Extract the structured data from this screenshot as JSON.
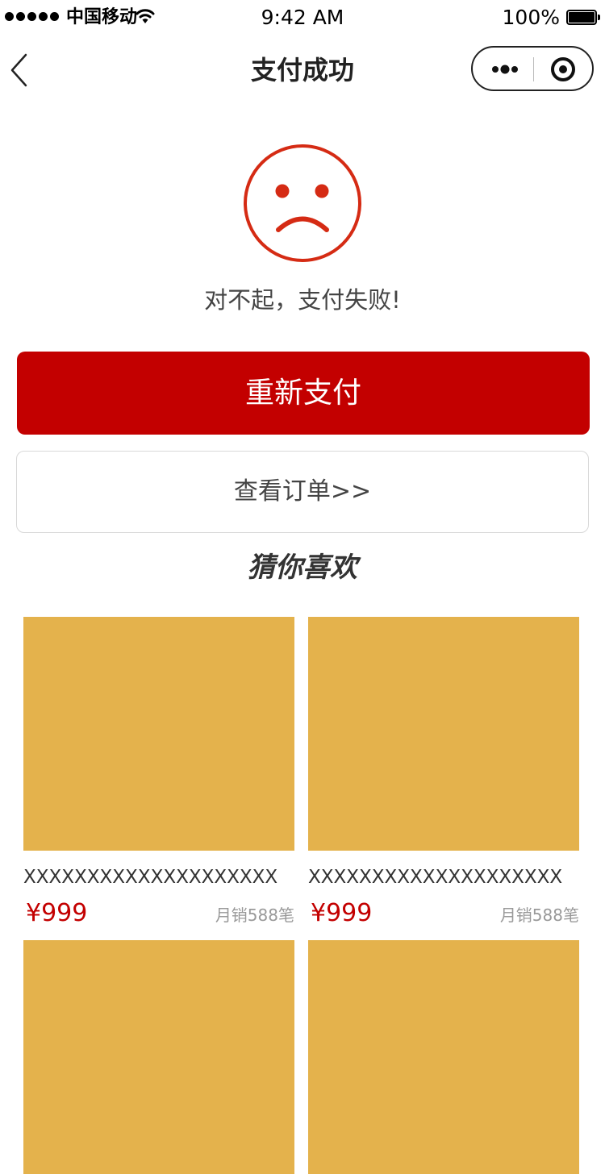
{
  "status_bar": {
    "carrier": "中国移动",
    "time": "9:42 AM",
    "battery": "100%",
    "signal_icon": "signal-dots-icon",
    "wifi_icon": "wifi-icon",
    "battery_icon": "battery-icon",
    "battery_level": 1.0
  },
  "nav": {
    "title": "支付成功",
    "back_icon": "chevron-left-icon",
    "more_icon": "more-dots-icon",
    "close_icon": "target-circle-icon"
  },
  "result": {
    "icon": "sad-face-icon",
    "message": "对不起，支付失败!",
    "icon_color": "#d52b14"
  },
  "actions": {
    "retry_label": "重新支付",
    "view_orders_label": "查看订单>>",
    "primary_color": "#c30000"
  },
  "recommendations": {
    "title": "猜你喜欢",
    "placeholder_color": "#e4b24c",
    "products": [
      {
        "name": "XXXXXXXXXXXXXXXXXXXX",
        "price": "¥999",
        "sales": "月销588笔"
      },
      {
        "name": "XXXXXXXXXXXXXXXXXXXX",
        "price": "¥999",
        "sales": "月销588笔"
      },
      {
        "name": "",
        "price": "",
        "sales": ""
      },
      {
        "name": "",
        "price": "",
        "sales": ""
      }
    ]
  }
}
